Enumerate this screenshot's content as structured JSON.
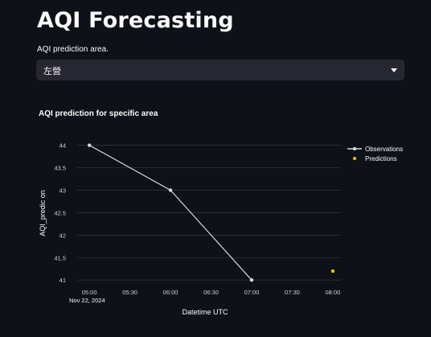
{
  "header": {
    "title": "AQI Forecasting"
  },
  "area_select": {
    "label": "AQI prediction area.",
    "value": "左營"
  },
  "colors": {
    "background": "#0e1117",
    "select_bg": "#262730",
    "observations": "#dcd6d8",
    "predictions": "#f2c200",
    "grid": "#2e3340"
  },
  "chart_data": {
    "type": "line",
    "title": "AQI prediction for specific area",
    "xlabel": "Datetime UTC",
    "ylabel": "AQI_predic on",
    "x_ticks": [
      "05:00",
      "05:30",
      "06:00",
      "06:30",
      "07:00",
      "07:30",
      "08:00"
    ],
    "x_tick_values": [
      5.0,
      5.5,
      6.0,
      6.5,
      7.0,
      7.5,
      8.0
    ],
    "x_date_label": "Nov 22, 2024",
    "y_ticks": [
      "44",
      "43.5",
      "43",
      "42.5",
      "42",
      "41.5",
      "41"
    ],
    "y_tick_values": [
      44,
      43.5,
      43,
      42.5,
      42,
      41.5,
      41
    ],
    "xlim": [
      4.85,
      8.1
    ],
    "ylim": [
      40.95,
      44.1
    ],
    "grid": true,
    "legend_position": "top-right",
    "series": [
      {
        "name": "Observations",
        "x": [
          5.0,
          6.0,
          7.0
        ],
        "y": [
          44,
          43,
          41
        ],
        "mode": "lines+markers"
      },
      {
        "name": "Predictions",
        "x": [
          8.0
        ],
        "y": [
          41.2
        ],
        "mode": "markers"
      }
    ]
  }
}
